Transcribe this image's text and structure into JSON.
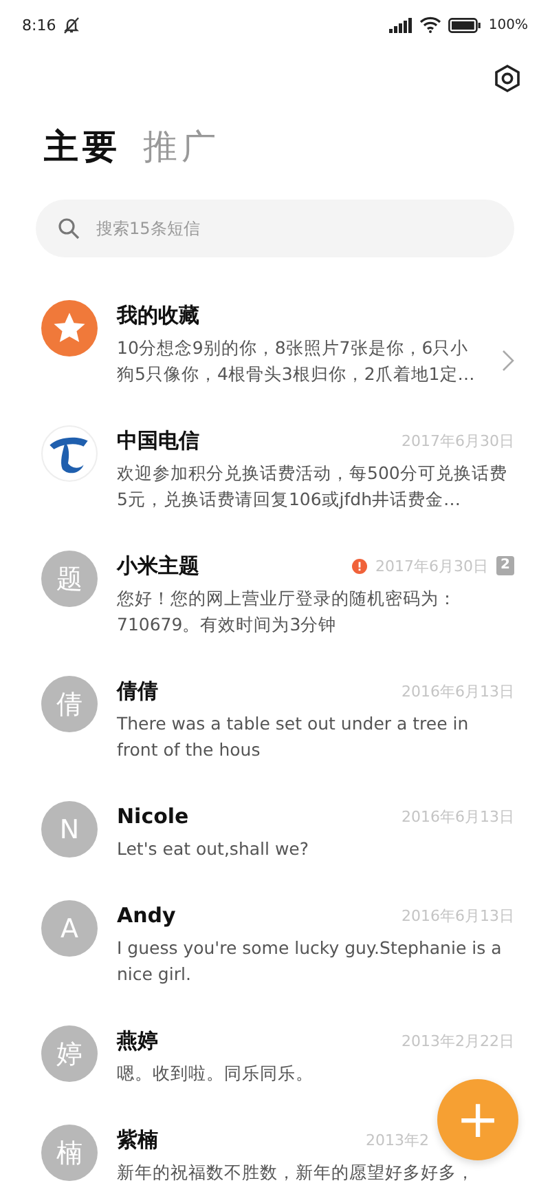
{
  "status_bar": {
    "time": "8:16",
    "battery": "100%"
  },
  "tabs": [
    {
      "label": "主要",
      "selected": true
    },
    {
      "label": "推广",
      "selected": false
    }
  ],
  "search": {
    "placeholder": "搜索15条短信"
  },
  "conversations": [
    {
      "kind": "star",
      "name": "我的收藏",
      "preview": "10分想念9别的你，8张照片7张是你，6只小狗5只像你，4根骨头3根归你，2爪着地1定…",
      "chevron": true,
      "alert": false
    },
    {
      "kind": "logo",
      "name": "中国电信",
      "date": "2017年6月30日",
      "preview": "欢迎参加积分兑换话费活动，每500分可兑换话费5元，兑换话费请回复106或jfdh井话费金…",
      "chevron": false,
      "alert": false
    },
    {
      "kind": "letter",
      "initial": "题",
      "name": "小米主题",
      "date": "2017年6月30日",
      "preview": "您好！您的网上营业厅登录的随机密码为：710679。有效时间为3分钟",
      "chevron": false,
      "alert": true,
      "badge": "2"
    },
    {
      "kind": "letter",
      "initial": "倩",
      "name": "倩倩",
      "date": "2016年6月13日",
      "preview": "There was a table set out under a tree in front of the hous",
      "chevron": false,
      "alert": false
    },
    {
      "kind": "letter",
      "initial": "N",
      "name": "Nicole",
      "date": "2016年6月13日",
      "preview": "Let's eat out,shall we?",
      "chevron": false,
      "alert": false
    },
    {
      "kind": "letter",
      "initial": "A",
      "name": "Andy",
      "date": "2016年6月13日",
      "preview": "I guess you're some lucky guy.Stephanie is a nice girl.",
      "chevron": false,
      "alert": false
    },
    {
      "kind": "letter",
      "initial": "婷",
      "name": "燕婷",
      "date": "2013年2月22日",
      "preview": "嗯。收到啦。同乐同乐。",
      "chevron": false,
      "alert": false
    },
    {
      "kind": "letter",
      "initial": "楠",
      "name": "紫楠",
      "date": "2013年2",
      "preview": "新年的祝福数不胜数，新年的愿望好多好多，",
      "chevron": false,
      "alert": false
    }
  ],
  "fab": {
    "label": "+"
  }
}
